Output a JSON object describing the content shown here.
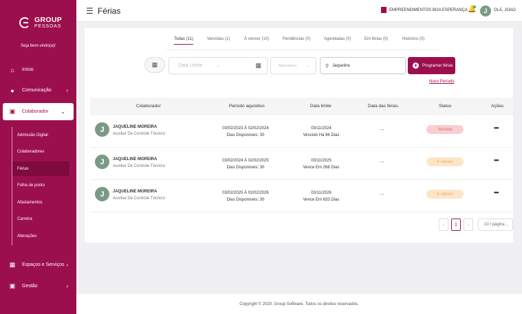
{
  "sidebar": {
    "logo_line1": "GROUP",
    "logo_line2": "PESSOAS",
    "welcome": "Seja bem-vindo(a)!",
    "items": [
      {
        "label": "Início",
        "icon": "home-icon"
      },
      {
        "label": "Comunicação",
        "icon": "chat-icon"
      },
      {
        "label": "Colaborador",
        "icon": "id-card-icon"
      },
      {
        "label": "Espaços e Serviços",
        "icon": "building-icon"
      },
      {
        "label": "Gestão",
        "icon": "briefcase-icon"
      }
    ],
    "submenu": [
      "Admissão Digital",
      "Colaboradores",
      "Férias",
      "Folha de ponto",
      "Afastamentos",
      "Carreira",
      "Alterações"
    ]
  },
  "topbar": {
    "title": "Férias",
    "company": "EMPREENDIMENTOS BOA ESPERANÇA",
    "user_initial": "J",
    "user_greeting": "OLÁ, JOAO"
  },
  "tabs": [
    "Todas (11)",
    "Vencidas (1)",
    "À vencer (10)",
    "Pendências (0)",
    "Agendadas (0)",
    "Em férias (0)",
    "Histórico (0)"
  ],
  "filters": {
    "date_placeholder": "Data Limite",
    "select_placeholder": "Assinatura",
    "search_value": "Jaqueline",
    "program_button": "Programar férias",
    "new_period_link": "Novo Período"
  },
  "table": {
    "headers": [
      "Colaborador",
      "Período aquisitivo",
      "Data limite",
      "Data das férias",
      "Status",
      "Ações"
    ],
    "rows": [
      {
        "initial": "J",
        "name": "JAQUELINE MOREIRA",
        "role": "Auxiliar De Controle Técnico",
        "period": "03/02/2023 À 02/02/2024",
        "available": "Dias Disponíveis: 30",
        "limit_date": "03/11/2024",
        "limit_status": "Vencido Há 96 Dias",
        "vacation_date": "---",
        "status": "Vencida"
      },
      {
        "initial": "J",
        "name": "JAQUELINE MOREIRA",
        "role": "Auxiliar De Controle Técnico",
        "period": "03/02/2024 À 02/02/2025",
        "available": "Dias Disponíveis: 30",
        "limit_date": "03/11/2025",
        "limit_status": "Vence Em 268 Dias",
        "vacation_date": "---",
        "status": "À vencer"
      },
      {
        "initial": "J",
        "name": "JAQUELINE MOREIRA",
        "role": "Auxiliar De Controle Técnico",
        "period": "03/02/2025 À 02/02/2026",
        "available": "Dias Disponíveis: 30",
        "limit_date": "03/11/2026",
        "limit_status": "Vence Em 633 Dias",
        "vacation_date": "---",
        "status": "À vencer"
      }
    ],
    "actions_icon": "more-horizontal-icon"
  },
  "pagination": {
    "prev": "‹",
    "current": "1",
    "next": "›",
    "page_size": "10 / página"
  },
  "footer": "Copyright © 2020. Group Software. Todos os direitos reservados.",
  "colors": {
    "brand": "#9c0f4e",
    "avatar": "#7a9a86",
    "overdue": "#e46b72",
    "upcoming": "#efa75a"
  }
}
